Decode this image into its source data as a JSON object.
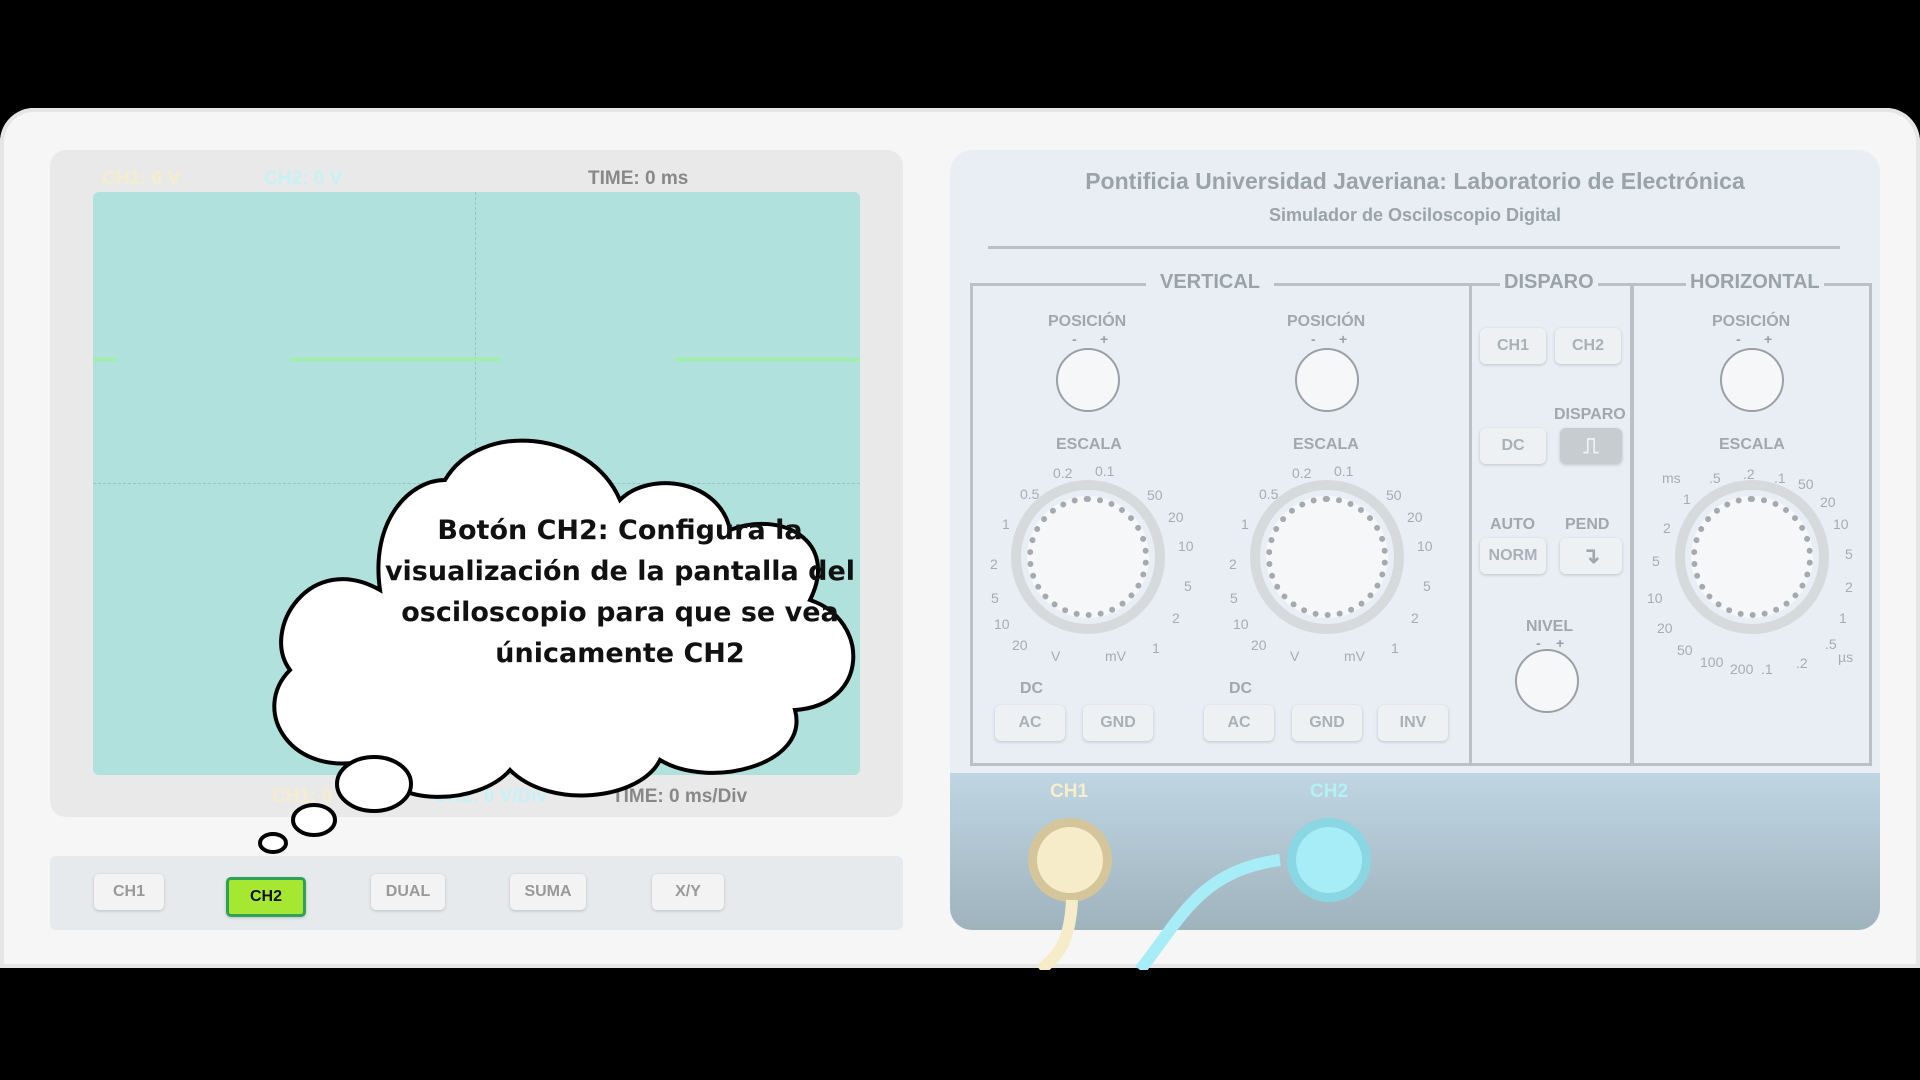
{
  "screen": {
    "ch1_readout": "CH1: 0 V",
    "ch2_readout": "CH2: 0 V",
    "time_readout": "TIME: 0 ms",
    "ch1_scale": "CH1: 0 V/Div",
    "ch2_scale": "CH2: 0 V/Div",
    "time_scale": "TIME: 0 ms/Div"
  },
  "modes": {
    "ch1": "CH1",
    "ch2": "CH2",
    "dual": "DUAL",
    "suma": "SUMA",
    "xy": "X/Y",
    "selected": "CH2"
  },
  "panel": {
    "title": "Pontificia Universidad Javeriana: Laboratorio de Electrónica",
    "subtitle": "Simulador de Osciloscopio Digital",
    "vertical": {
      "label": "VERTICAL",
      "posicion": "POSICIÓN",
      "escala": "ESCALA",
      "minus": "-",
      "plus": "+",
      "dc": "DC",
      "ac": "AC",
      "gnd": "GND",
      "inv": "INV",
      "units": {
        "v": "V",
        "mv": "mV"
      },
      "ticks": [
        "0.2",
        "0.1",
        "0.5",
        "50",
        "20",
        "1",
        "10",
        "2",
        "5",
        "5",
        "2",
        "10",
        "20",
        "1"
      ]
    },
    "disparo": {
      "label": "DISPARO",
      "ch1": "CH1",
      "ch2": "CH2",
      "dc": "DC",
      "disparo": "DISPARO",
      "auto": "AUTO",
      "pend": "PEND",
      "norm": "NORM",
      "nivel": "NIVEL"
    },
    "horizontal": {
      "label": "HORIZONTAL",
      "posicion": "POSICIÓN",
      "escala": "ESCALA",
      "units": {
        "ms": "ms",
        "us": "µs"
      },
      "ticks": [
        ".5",
        ".2",
        ".1",
        "1",
        "50",
        "20",
        "2",
        "10",
        "5",
        "5",
        "2",
        "10",
        "1",
        "20",
        ".5",
        "50",
        "100",
        "200",
        ".1",
        ".2"
      ]
    },
    "connectors": {
      "ch1": "CH1",
      "ch2": "CH2"
    },
    "colors": {
      "ch1": "#f6ecc9",
      "ch2": "#a7edf7"
    }
  },
  "callout": {
    "text": "Botón CH2: Configura la visualización de la pantalla del osciloscopio para que se vea únicamente CH2"
  }
}
